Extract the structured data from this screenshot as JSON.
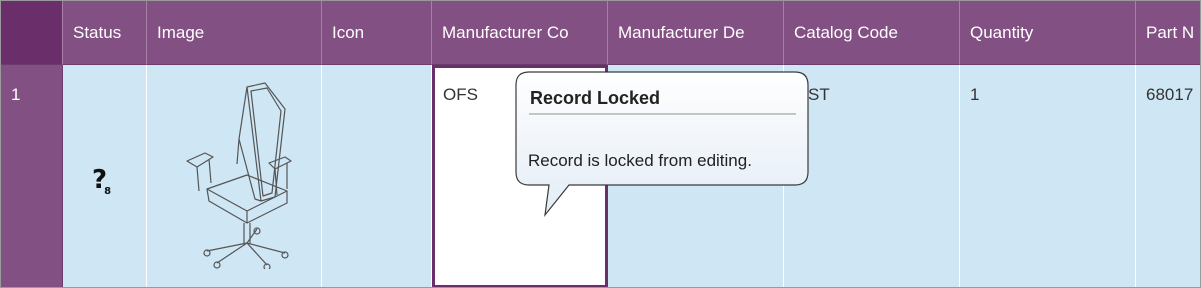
{
  "grid": {
    "columns": [
      "Status",
      "Image",
      "Icon",
      "Manufacturer Co",
      "Manufacturer De",
      "Catalog Code",
      "Quantity",
      "Part N"
    ],
    "rows": [
      {
        "row_number": "1",
        "status_icon": "question-badge-icon",
        "image": "office-chair-image",
        "manufacturer_code": "OFS",
        "catalog_code_visible": "ST",
        "quantity": "1",
        "part_number_visible": "68017"
      }
    ]
  },
  "tooltip": {
    "title": "Record Locked",
    "message": "Record is locked from editing."
  },
  "colors": {
    "header_bg": "#825082",
    "row_bg": "#cfe6f4",
    "edit_border": "#6a2e6a"
  }
}
